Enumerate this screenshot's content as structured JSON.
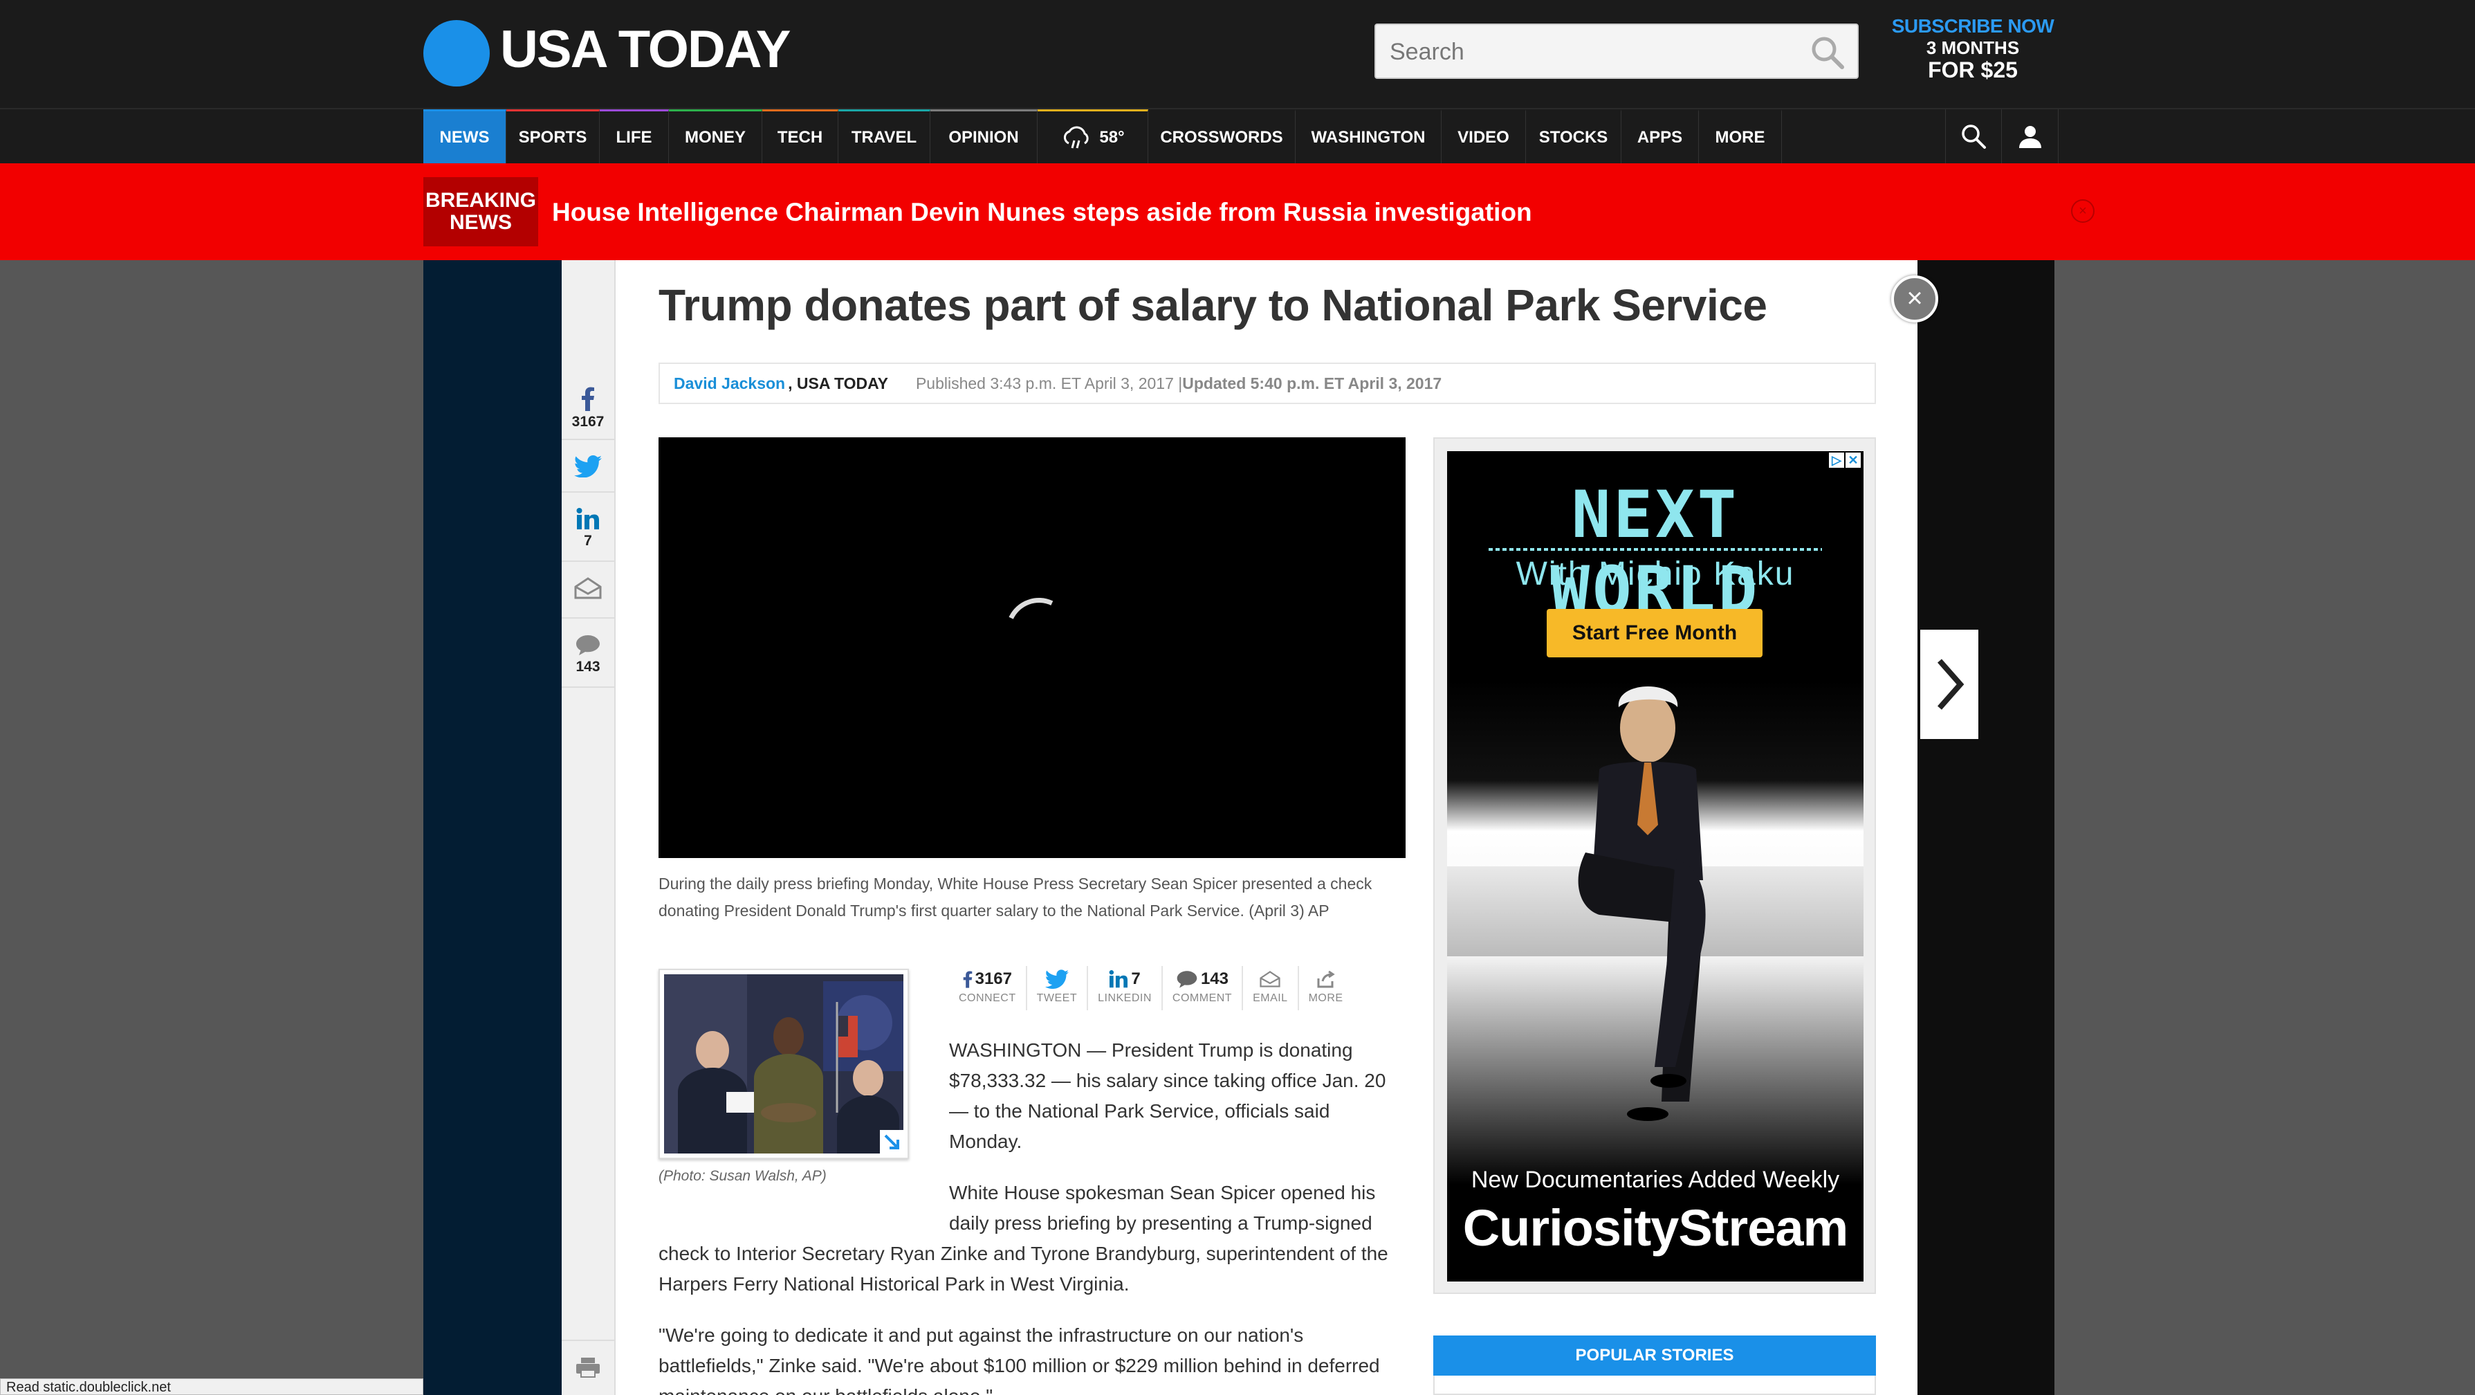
{
  "header": {
    "logo_text": "USA TODAY",
    "search_placeholder": "Search",
    "subscribe_line1": "SUBSCRIBE NOW",
    "subscribe_line2": "3 MONTHS",
    "subscribe_line3": "FOR $25"
  },
  "nav": {
    "items": [
      "NEWS",
      "SPORTS",
      "LIFE",
      "MONEY",
      "TECH",
      "TRAVEL",
      "OPINION"
    ],
    "weather_temp": "58°",
    "items_right": [
      "CROSSWORDS",
      "WASHINGTON",
      "VIDEO",
      "STOCKS",
      "APPS",
      "MORE"
    ],
    "active": "NEWS"
  },
  "breaking": {
    "tag_line1": "BREAKING",
    "tag_line2": "NEWS",
    "headline": "House Intelligence Chairman Devin Nunes steps aside from Russia investigation",
    "close": "×"
  },
  "share_rail": {
    "facebook_count": "3167",
    "linkedin_count": "7",
    "comment_count": "143"
  },
  "article": {
    "title": "Trump donates part of salary to National Park Service",
    "author": "David Jackson",
    "org": ", USA TODAY",
    "published": "Published 3:43 p.m. ET April 3, 2017 | ",
    "updated": "Updated 5:40 p.m. ET April 3, 2017",
    "video_caption": "During the daily press briefing Monday, White House Press Secretary Sean Spicer presented a check donating President Donald Trump's first quarter salary to the National Park Service. (April 3) AP",
    "photo_credit": "(Photo: Susan Walsh, AP)",
    "paragraph1": "WASHINGTON — President Trump is donating $78,333.32 — his salary since taking office Jan. 20 — to the National Park Service, officials said Monday.",
    "paragraph2a": "White House spokesman Sean Spicer opened his daily press briefing by presenting a Trump-signed",
    "paragraph2b": "check to Interior Secretary Ryan Zinke and Tyrone Brandyburg, superintendent of the Harpers Ferry National Historical Park in West Virginia.",
    "paragraph3": "\"We're going to dedicate it and put against the infrastructure on our nation's battlefields,\" Zinke said. \"We're about $100 million or $229 million behind in deferred maintenance on our battlefields alone.\""
  },
  "share_bar": {
    "connect_count": "3167",
    "connect_label": "CONNECT",
    "tweet_label": "TWEET",
    "linkedin_count": "7",
    "linkedin_label": "LINKEDIN",
    "comment_count": "143",
    "comment_label": "COMMENT",
    "email_label": "EMAIL",
    "more_label": "MORE"
  },
  "ad": {
    "title": "NEXT WORLD",
    "subtitle": "With Michio Kaku",
    "cta": "Start Free Month",
    "tagline": "New Documentaries Added Weekly",
    "brand": "CuriosityStream"
  },
  "popular_stories": "POPULAR STORIES",
  "status_bar": "Read static.doubleclick.net",
  "colors": {
    "brand_blue": "#1a90e8",
    "breaking_red": "#f20000",
    "nav_bg": "#1b1b1b"
  }
}
